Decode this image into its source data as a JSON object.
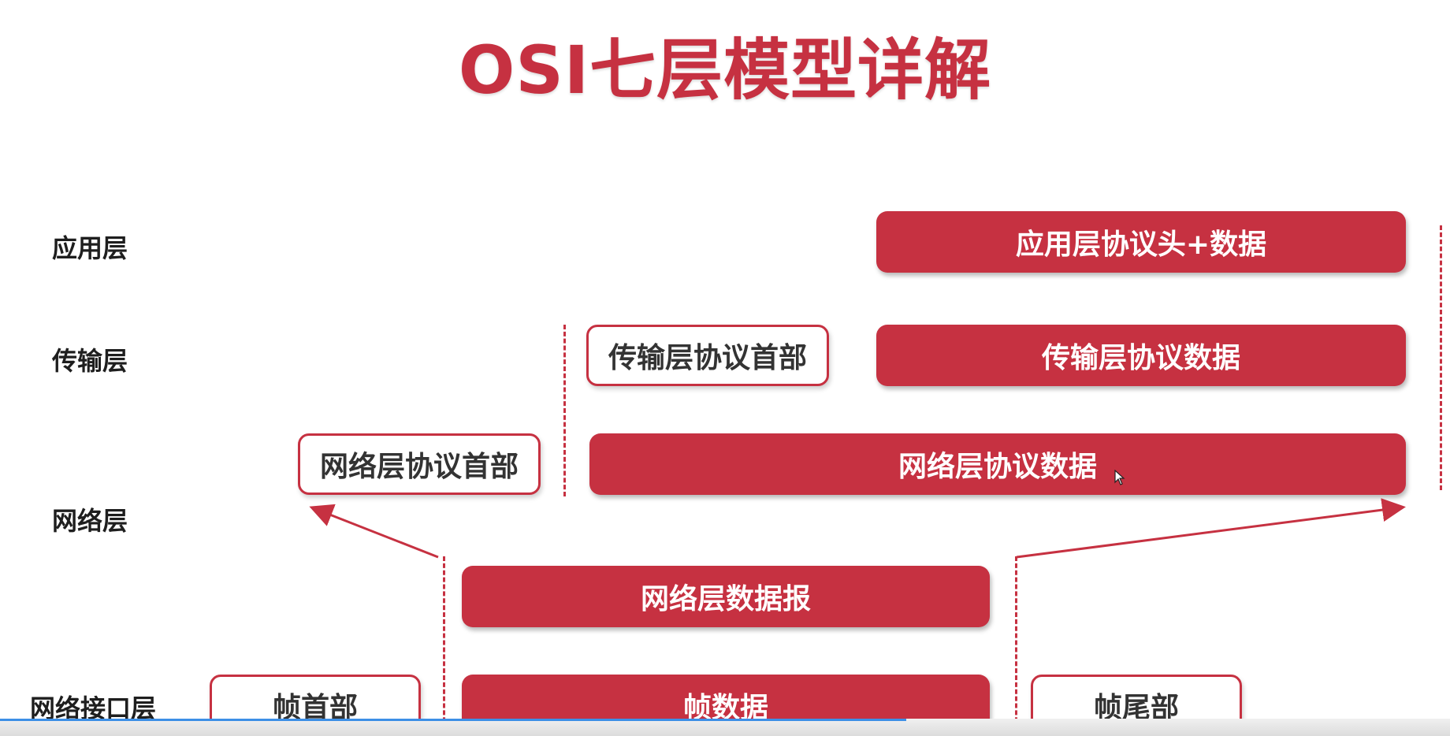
{
  "title": "OSI七层模型详解",
  "colors": {
    "accent": "#c63141",
    "label_text": "#1e1e1e",
    "outline_text": "#333333",
    "progress": "#3d8fe6"
  },
  "layer_labels": {
    "application": "应用层",
    "transport": "传输层",
    "network": "网络层",
    "link": "网络接口层"
  },
  "blocks": {
    "app_header_data": "应用层协议头+数据",
    "transport_header": "传输层协议首部",
    "transport_data": "传输层协议数据",
    "network_header": "网络层协议首部",
    "network_data": "网络层协议数据",
    "network_datagram": "网络层数据报",
    "frame_header": "帧首部",
    "frame_data": "帧数据",
    "frame_trailer": "帧尾部"
  },
  "video_progress": 0.625
}
